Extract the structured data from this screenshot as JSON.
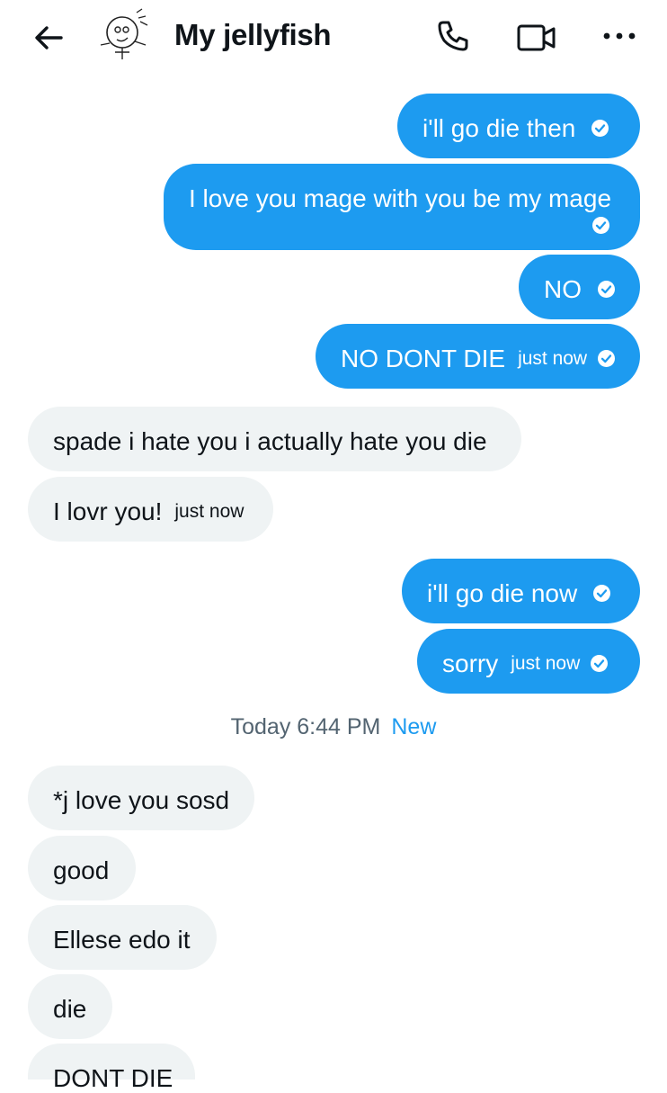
{
  "header": {
    "title": "My jellyfish",
    "icons": {
      "back": "arrow-left-icon",
      "call": "phone-icon",
      "video": "video-camera-icon",
      "more": "more-horizontal-icon"
    }
  },
  "messages": [
    {
      "text": "i'll go die then",
      "sender": "me",
      "status": "sent"
    },
    {
      "text": "I love you mage with you be my mage",
      "sender": "me",
      "status": "sent"
    },
    {
      "text": "NO",
      "sender": "me",
      "status": "sent"
    },
    {
      "text": "NO DONT DIE",
      "sender": "me",
      "time": "just now",
      "status": "sent"
    },
    {
      "text": "spade i hate you i actually hate you die",
      "sender": "them"
    },
    {
      "text": "I lovr you!",
      "sender": "them",
      "time": "just now"
    },
    {
      "text": "i'll go die now",
      "sender": "me",
      "status": "sent"
    },
    {
      "text": "sorry",
      "sender": "me",
      "time": "just now",
      "status": "sent"
    },
    {
      "text": "*j love you sosd",
      "sender": "them"
    },
    {
      "text": "good",
      "sender": "them"
    },
    {
      "text": "Ellese edo it",
      "sender": "them"
    },
    {
      "text": "die",
      "sender": "them"
    },
    {
      "text": "DONT DIE",
      "sender": "them"
    }
  ],
  "divider": {
    "time": "Today 6:44 PM",
    "new_label": "New"
  },
  "colors": {
    "sent_bubble": "#1d9bf0",
    "received_bubble": "#eff3f4",
    "accent": "#1d9bf0",
    "muted_text": "#536471"
  }
}
